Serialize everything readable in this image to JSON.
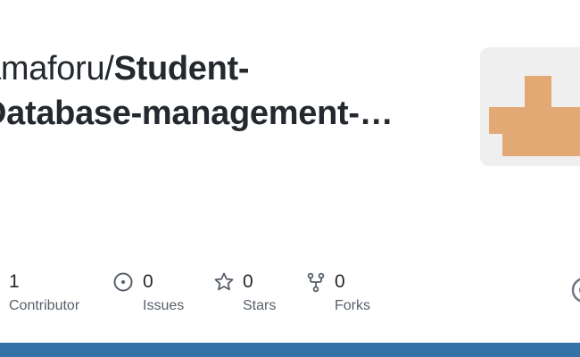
{
  "repo": {
    "owner": "amaforu/",
    "name_line1": "Student-",
    "name_line2": "Database-management-…"
  },
  "stats": {
    "contributors": {
      "count": "1",
      "label": "Contributor",
      "icon": "people-icon"
    },
    "issues": {
      "count": "0",
      "label": "Issues",
      "icon": "issue-opened-icon"
    },
    "stars": {
      "count": "0",
      "label": "Stars",
      "icon": "star-icon"
    },
    "forks": {
      "count": "0",
      "label": "Forks",
      "icon": "repo-forked-icon"
    }
  },
  "colors": {
    "language_bar": "#3572a5",
    "identicon": "#e2a974",
    "avatar_bg": "#efefef"
  },
  "icons": {
    "avatar": "identicon-avatar",
    "brand": "github-mark-icon"
  }
}
